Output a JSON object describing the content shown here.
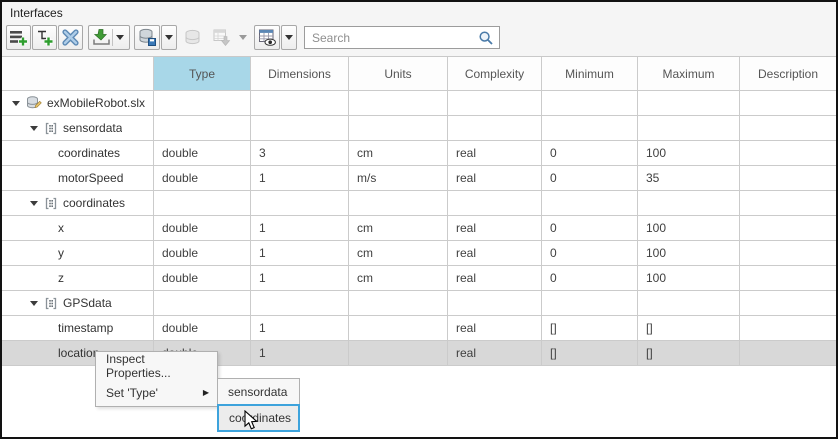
{
  "panel": {
    "title": "Interfaces"
  },
  "toolbar": {
    "search_placeholder": "Search",
    "buttons": [
      {
        "name": "add-interface",
        "enabled": true,
        "has_dropdown": false
      },
      {
        "name": "add-element",
        "enabled": true,
        "has_dropdown": false
      },
      {
        "name": "delete",
        "enabled": true,
        "has_dropdown": false
      },
      {
        "name": "import",
        "enabled": true,
        "has_dropdown": true
      },
      {
        "name": "save-dictionary",
        "enabled": true,
        "has_dropdown": true
      },
      {
        "name": "link-dictionary",
        "enabled": false,
        "has_dropdown": false
      },
      {
        "name": "export",
        "enabled": false,
        "has_dropdown": true
      },
      {
        "name": "column-view",
        "enabled": true,
        "has_dropdown": true
      }
    ]
  },
  "table": {
    "columns": [
      "",
      "Type",
      "Dimensions",
      "Units",
      "Complexity",
      "Minimum",
      "Maximum",
      "Description"
    ],
    "highlighted_column": "Type",
    "rows": [
      {
        "label": "exMobileRobot.slx",
        "level": 0,
        "icon": "dictionary",
        "expanded": true,
        "selected": false,
        "cells": [
          "",
          "",
          "",
          "",
          "",
          "",
          ""
        ]
      },
      {
        "label": "sensordata",
        "level": 1,
        "icon": "interface",
        "expanded": true,
        "selected": false,
        "cells": [
          "",
          "",
          "",
          "",
          "",
          "",
          ""
        ]
      },
      {
        "label": "coordinates",
        "level": 2,
        "icon": "",
        "expanded": false,
        "selected": false,
        "cells": [
          "double",
          "3",
          "cm",
          "real",
          "0",
          "100",
          ""
        ]
      },
      {
        "label": "motorSpeed",
        "level": 2,
        "icon": "",
        "expanded": false,
        "selected": false,
        "cells": [
          "double",
          "1",
          "m/s",
          "real",
          "0",
          "35",
          ""
        ]
      },
      {
        "label": "coordinates",
        "level": 1,
        "icon": "interface",
        "expanded": true,
        "selected": false,
        "cells": [
          "",
          "",
          "",
          "",
          "",
          "",
          ""
        ]
      },
      {
        "label": "x",
        "level": 2,
        "icon": "",
        "expanded": false,
        "selected": false,
        "cells": [
          "double",
          "1",
          "cm",
          "real",
          "0",
          "100",
          ""
        ]
      },
      {
        "label": "y",
        "level": 2,
        "icon": "",
        "expanded": false,
        "selected": false,
        "cells": [
          "double",
          "1",
          "cm",
          "real",
          "0",
          "100",
          ""
        ]
      },
      {
        "label": "z",
        "level": 2,
        "icon": "",
        "expanded": false,
        "selected": false,
        "cells": [
          "double",
          "1",
          "cm",
          "real",
          "0",
          "100",
          ""
        ]
      },
      {
        "label": "GPSdata",
        "level": 1,
        "icon": "interface",
        "expanded": true,
        "selected": false,
        "cells": [
          "",
          "",
          "",
          "",
          "",
          "",
          ""
        ]
      },
      {
        "label": "timestamp",
        "level": 2,
        "icon": "",
        "expanded": false,
        "selected": false,
        "cells": [
          "double",
          "1",
          "",
          "real",
          "[]",
          "[]",
          ""
        ]
      },
      {
        "label": "location",
        "level": 2,
        "icon": "",
        "expanded": false,
        "selected": true,
        "cells": [
          "double",
          "1",
          "",
          "real",
          "[]",
          "[]",
          ""
        ]
      }
    ]
  },
  "context_menu": {
    "items": [
      {
        "label": "Inspect Properties...",
        "has_submenu": false
      },
      {
        "label": "Set 'Type'",
        "has_submenu": true
      }
    ]
  },
  "type_submenu": {
    "items": [
      {
        "label": "sensordata",
        "highlighted": false
      },
      {
        "label": "coordinates",
        "highlighted": true
      }
    ]
  },
  "colors": {
    "header_highlight": "#a8d7e8",
    "selection": "#d8d8d8",
    "submenu_highlight_border": "#3da3dc"
  }
}
